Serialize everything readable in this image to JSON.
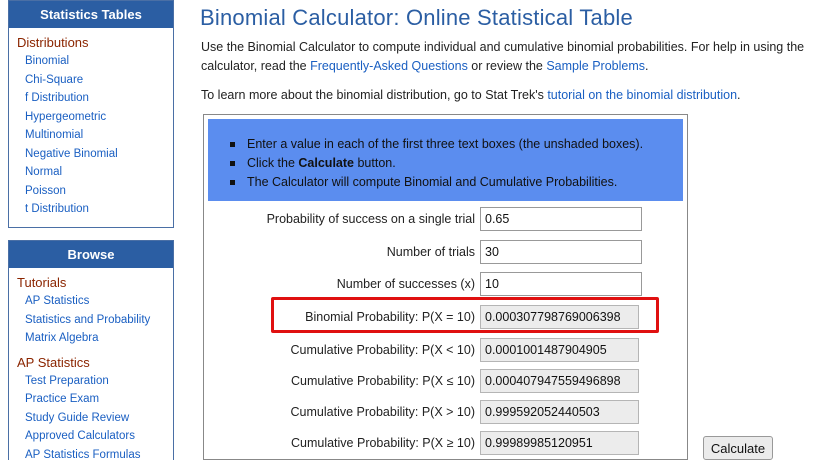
{
  "sidebar": {
    "box1": {
      "header": "Statistics Tables",
      "section": "Distributions",
      "items": [
        "Binomial",
        "Chi-Square",
        "f Distribution",
        "Hypergeometric",
        "Multinomial",
        "Negative Binomial",
        "Normal",
        "Poisson",
        "t Distribution"
      ]
    },
    "box2": {
      "header": "Browse",
      "section1": "Tutorials",
      "tutorials": [
        "AP Statistics",
        "Statistics and Probability",
        "Matrix Algebra"
      ],
      "section2": "AP Statistics",
      "ap_items": [
        "Test Preparation",
        "Practice Exam",
        "Study Guide Review",
        "Approved Calculators",
        "AP Statistics Formulas"
      ]
    }
  },
  "main": {
    "title": "Binomial Calculator: Online Statistical Table",
    "intro_1": "Use the Binomial Calculator to compute individual and cumulative binomial probabilities. For help in using the calculator, read the ",
    "faq_link": "Frequently-Asked Questions",
    "intro_2": " or review the ",
    "sample_link": "Sample Problems",
    "intro_3": ".",
    "learn_text": "To learn more about the binomial distribution, go to Stat Trek's ",
    "tutorial_link": "tutorial on the binomial distribution",
    "learn_end": ".",
    "instructions": {
      "line1": "Enter a value in each of the first three text boxes (the unshaded boxes).",
      "line2_pre": "Click the ",
      "line2_bold": "Calculate",
      "line2_post": " button.",
      "line3": "The Calculator will compute Binomial and Cumulative Probabilities."
    },
    "inputs": [
      {
        "label": "Probability of success on a single trial",
        "value": "0.65"
      },
      {
        "label": "Number of trials",
        "value": "30"
      },
      {
        "label": "Number of successes (x)",
        "value": "10"
      }
    ],
    "outputs": [
      {
        "label": "Binomial Probability: P(X = 10)",
        "value": "0.000307798769006398"
      },
      {
        "label": "Cumulative Probability: P(X < 10)",
        "value": "0.0001001487904905"
      },
      {
        "label": "Cumulative Probability: P(X ≤ 10)",
        "value": "0.000407947559496898"
      },
      {
        "label": "Cumulative Probability: P(X > 10)",
        "value": "0.999592052440503"
      },
      {
        "label": "Cumulative Probability: P(X ≥ 10)",
        "value": "0.99989985120951"
      }
    ],
    "calculate_label": "Calculate",
    "highlight_color": "#e01010"
  }
}
